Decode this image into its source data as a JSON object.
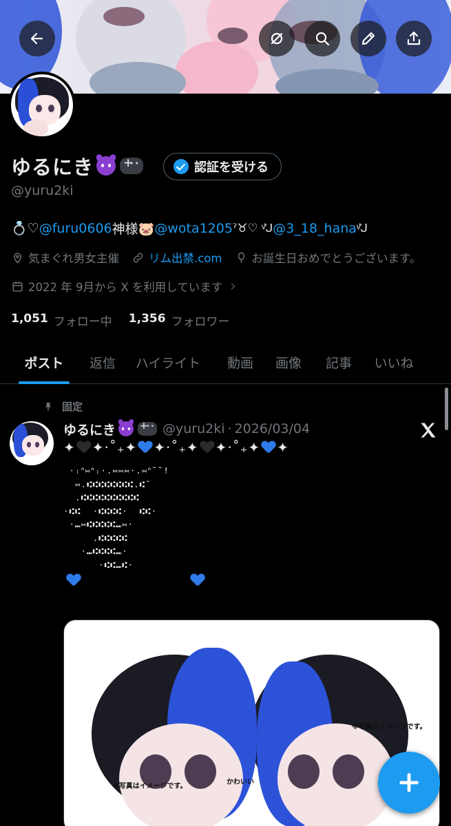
{
  "header": {
    "back_icon": "arrow-left-icon",
    "actions": [
      "translate-icon",
      "search-icon",
      "edit-icon",
      "share-icon"
    ]
  },
  "profile": {
    "display_name": "ゆるにき",
    "verify_label": "認証を受ける",
    "handle": "@yuru2ki",
    "bio": {
      "prefix": "💍♡",
      "mention1": "@furu0606",
      "text1": " 神様🐷 ",
      "mention2": "@wota1205",
      "text2": "ˀ♉♡ ᵛ͛ᒍ",
      "mention3": "@3_18_hana",
      "suffix": "ᵛ͛ᒍ"
    },
    "location": "気まぐれ男女主催",
    "website": "リム出禁.com",
    "birthday": "お誕生日おめでとうございます。",
    "joined": "2022 年 9月から X を利用しています",
    "following_count": "1,051",
    "following_label": "フォロー中",
    "followers_count": "1,356",
    "followers_label": "フォロワー"
  },
  "tabs": [
    {
      "label": "ポスト",
      "active": true
    },
    {
      "label": "返信",
      "active": false
    },
    {
      "label": "ハイライト",
      "active": false
    },
    {
      "label": "動画",
      "active": false
    },
    {
      "label": "画像",
      "active": false
    },
    {
      "label": "記事",
      "active": false
    },
    {
      "label": "いいね",
      "active": false
    }
  ],
  "post": {
    "pinned_label": "固定",
    "author_name": "ゆるにき",
    "author_handle": "@yuru2ki",
    "separator": "·",
    "date": "2026/03/04",
    "deco_stars": "✦",
    "deco_dot": "·˚₊",
    "ascii_art": " ·₍ᐢ⑅ᐢ₎·.⑅⑅⑅·.⑅ᐢ˘˘!\n  ⑅.⑆⑆⑆⑆⑆⑆⑆⑆.⑆˘\n  .⑆⑆⑆⑆⑆⑆⑆⑆⑆⑆\n·⑆⑆  ·⑆⑆⑆⑆·  ⑆⑆·\n ·⑉⑅⑆⑆⑆⑆⑆⑉⑅·\n     .⑆⑆⑆⑆⑆\n   ·⑉⑆⑆⑆⑆⑉·\n      ·⑆⑆⑉⑆·",
    "media_notes": [
      "※写真はイメージです。",
      "※写真はイメージです。",
      "かわいい"
    ]
  },
  "colors": {
    "accent": "#1d9bf0",
    "background": "#000000",
    "text_primary": "#e7e9ea",
    "text_secondary": "#71767b"
  },
  "fab_icon": "plus-icon"
}
